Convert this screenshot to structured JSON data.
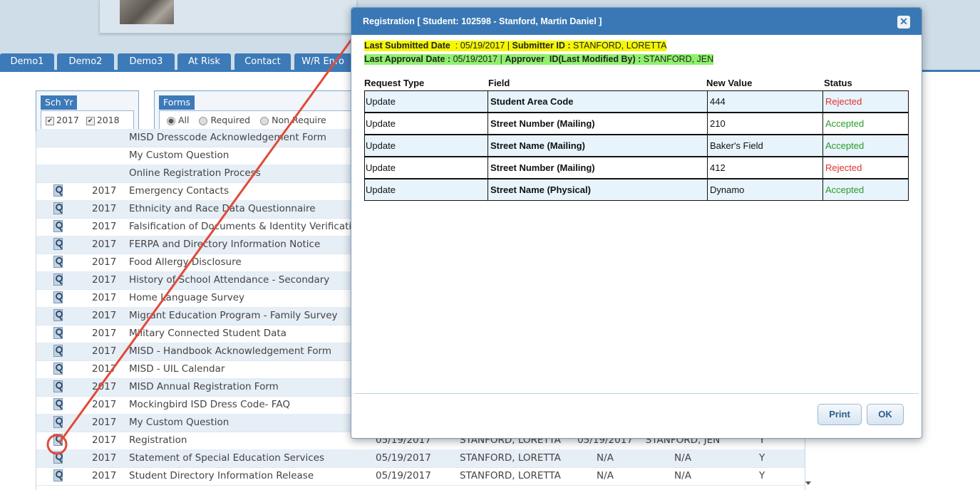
{
  "tabs": [
    "Demo1",
    "Demo2",
    "Demo3",
    "At Risk",
    "Contact",
    "W/R Enro"
  ],
  "filters": {
    "sch_yr": {
      "label": "Sch Yr",
      "options": [
        "2017",
        "2018"
      ],
      "checked": [
        true,
        true
      ]
    },
    "forms": {
      "label": "Forms",
      "options": [
        "All",
        "Required",
        "Non Require"
      ],
      "selected": "All"
    }
  },
  "grid_rows": [
    {
      "year": "",
      "form": "MISD Dresscode Acknowledgement Form",
      "icon": false
    },
    {
      "year": "",
      "form": "My Custom Question",
      "icon": false
    },
    {
      "year": "",
      "form": "Online Registration Process",
      "icon": false
    },
    {
      "year": "2017",
      "form": "Emergency Contacts",
      "icon": true
    },
    {
      "year": "2017",
      "form": "Ethnicity and Race Data Questionnaire",
      "icon": true
    },
    {
      "year": "2017",
      "form": "Falsification of Documents & Identity Verificatio",
      "icon": true
    },
    {
      "year": "2017",
      "form": "FERPA and Directory Information Notice",
      "icon": true
    },
    {
      "year": "2017",
      "form": "Food Allergy Disclosure",
      "icon": true
    },
    {
      "year": "2017",
      "form": "History of School Attendance - Secondary",
      "icon": true
    },
    {
      "year": "2017",
      "form": "Home Language Survey",
      "icon": true
    },
    {
      "year": "2017",
      "form": "Migrant Education Program - Family Survey",
      "icon": true
    },
    {
      "year": "2017",
      "form": "Military Connected Student Data",
      "icon": true
    },
    {
      "year": "2017",
      "form": "MISD - Handbook Acknowledgement Form",
      "icon": true
    },
    {
      "year": "2017",
      "form": "MISD - UIL Calendar",
      "icon": true
    },
    {
      "year": "2017",
      "form": "MISD Annual Registration Form",
      "icon": true
    },
    {
      "year": "2017",
      "form": "Mockingbird ISD Dress Code- FAQ",
      "icon": true
    },
    {
      "year": "2017",
      "form": "My Custom Question",
      "icon": true
    },
    {
      "year": "2017",
      "form": "Registration",
      "icon": true,
      "submitted": "05/19/2017",
      "submitter": "STANFORD, LORETTA",
      "approved": "05/19/2017",
      "approver": "STANFORD, JEN",
      "flag": "Y"
    },
    {
      "year": "2017",
      "form": "Statement of Special Education Services",
      "icon": true,
      "submitted": "05/19/2017",
      "submitter": "STANFORD, LORETTA",
      "approved": "N/A",
      "approver": "N/A",
      "flag": "Y"
    },
    {
      "year": "2017",
      "form": "Student Directory Information Release",
      "icon": true,
      "submitted": "05/19/2017",
      "submitter": "STANFORD, LORETTA",
      "approved": "N/A",
      "approver": "N/A",
      "flag": "Y"
    }
  ],
  "dialog": {
    "title": "Registration [ Student: 102598 - Stanford, Martin Daniel ]",
    "close_icon": "close-icon",
    "line1": {
      "submitted_label": "Last Submitted Date",
      "submitted_sep": "  : ",
      "submitted_value": "05/19/2017 | ",
      "submitter_label": "Submitter ID : ",
      "submitter_value": "STANFORD, LORETTA"
    },
    "line2": {
      "approval_label": "Last Approval Date :",
      "approval_value": " 05/19/2017 | ",
      "approver_label": "Approver  ID(Last Modified By) : ",
      "approver_value": "STANFORD, JEN"
    },
    "columns": [
      "Request Type",
      "Field",
      "New Value",
      "Status"
    ],
    "rows": [
      {
        "type": "Update",
        "field": "Student Area Code",
        "value": "444",
        "status": "Rejected"
      },
      {
        "type": "Update",
        "field": "Street Number (Mailing)",
        "value": "210",
        "status": "Accepted"
      },
      {
        "type": "Update",
        "field": "Street Name (Mailing)",
        "value": "Baker's Field",
        "status": "Accepted"
      },
      {
        "type": "Update",
        "field": "Street Number (Mailing)",
        "value": "412",
        "status": "Rejected"
      },
      {
        "type": "Update",
        "field": "Street Name (Physical)",
        "value": "Dynamo",
        "status": "Accepted"
      }
    ],
    "buttons": {
      "print": "Print",
      "ok": "OK"
    }
  },
  "colors": {
    "accent": "#3d7ab8",
    "rejected": "#e03030",
    "accepted": "#2a9a2a",
    "highlight_yellow": "#f6f600",
    "highlight_green": "#8ff06c",
    "annotation_arrow": "#e04a3a"
  }
}
